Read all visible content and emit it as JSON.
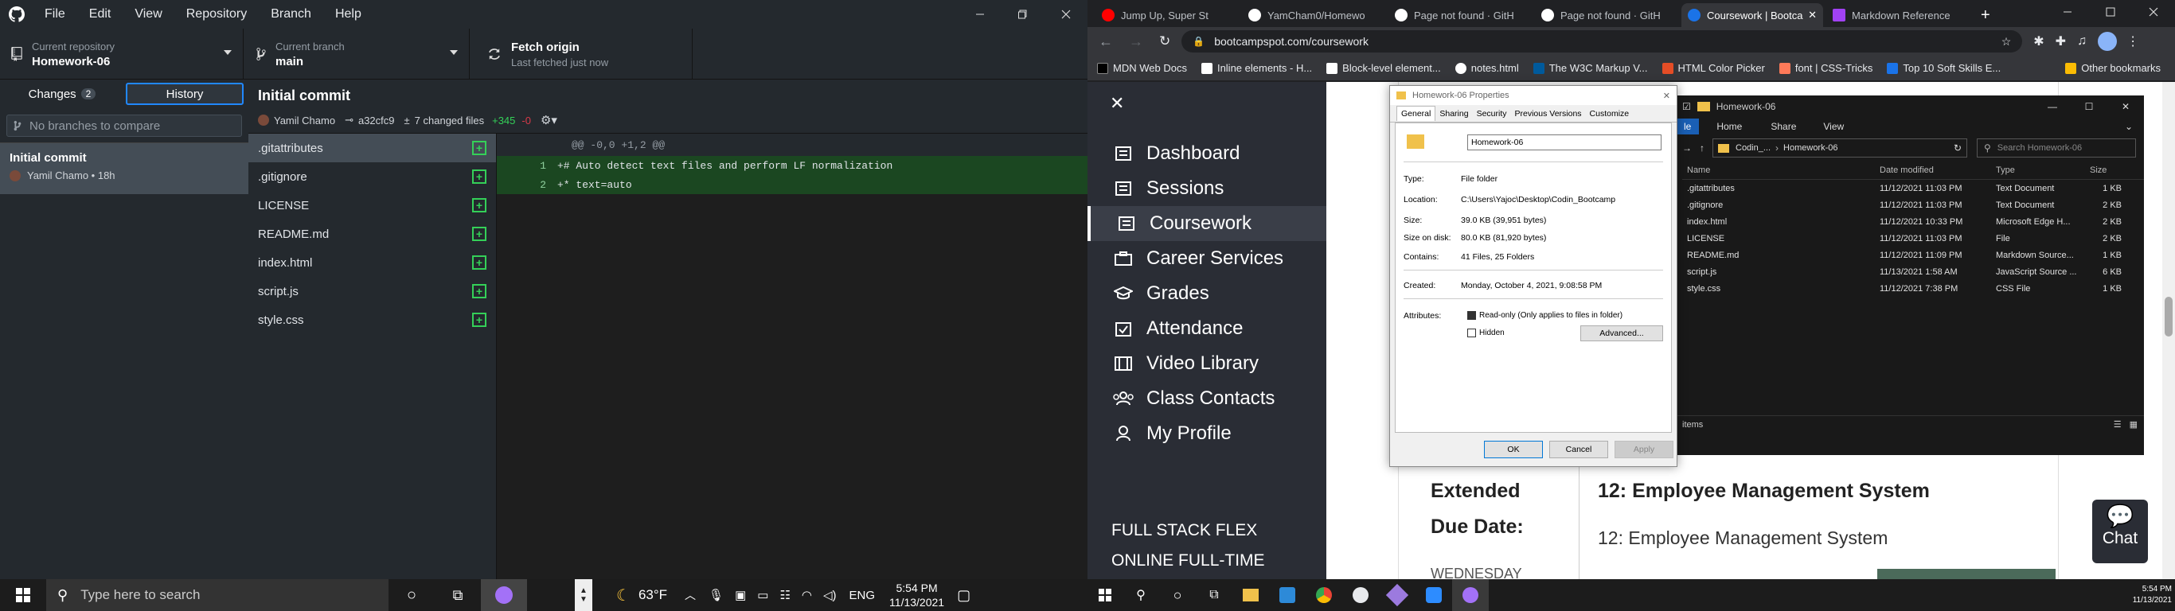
{
  "github": {
    "menu": [
      "File",
      "Edit",
      "View",
      "Repository",
      "Branch",
      "Help"
    ],
    "repo_label": "Current repository",
    "repo_value": "Homework-06",
    "branch_label": "Current branch",
    "branch_value": "main",
    "fetch_label": "Fetch origin",
    "fetch_sub": "Last fetched just now",
    "tab_changes": "Changes",
    "tab_changes_count": "2",
    "tab_history": "History",
    "filter_placeholder": "No branches to compare",
    "commit_title": "Initial commit",
    "commit_meta": "Yamil Chamo • 18h",
    "header_title": "Initial commit",
    "header_author": "Yamil Chamo",
    "header_sha": "a32cfc9",
    "header_files": "7 changed files",
    "header_add": "+345",
    "header_del": "-0",
    "files": [
      ".gitattributes",
      ".gitignore",
      "LICENSE",
      "README.md",
      "index.html",
      "script.js",
      "style.css"
    ],
    "diff_hunk": "@@ -0,0 +1,2 @@",
    "diff_lines": [
      {
        "n": "1",
        "text": "+# Auto detect text files and perform LF normalization"
      },
      {
        "n": "2",
        "text": "+* text=auto"
      }
    ]
  },
  "taskbar_left": {
    "search_placeholder": "Type here to search",
    "weather": "63°F",
    "lang": "ENG",
    "time": "5:54 PM",
    "date": "11/13/2021"
  },
  "chrome": {
    "tabs": [
      {
        "title": "Jump Up, Super St",
        "color": "#ff0000"
      },
      {
        "title": "YamCham0/Homewo",
        "color": "#ffffff"
      },
      {
        "title": "Page not found · GitH",
        "color": "#ffffff"
      },
      {
        "title": "Page not found · GitH",
        "color": "#ffffff"
      },
      {
        "title": "Coursework | Bootca",
        "color": "#1a73e8"
      },
      {
        "title": "Markdown Reference",
        "color": "#a142f4"
      }
    ],
    "url": "bootcampspot.com/coursework",
    "bookmarks": [
      "MDN Web Docs",
      "Inline elements - H...",
      "Block-level element...",
      "notes.html",
      "The W3C Markup V...",
      "HTML Color Picker",
      "font | CSS-Tricks",
      "Top 10 Soft Skills E..."
    ],
    "other_bookmarks": "Other bookmarks",
    "nav": [
      "Dashboard",
      "Sessions",
      "Coursework",
      "Career Services",
      "Grades",
      "Attendance",
      "Video Library",
      "Class Contacts",
      "My Profile"
    ],
    "nav_footer1": "FULL STACK FLEX",
    "nav_footer2": "ONLINE FULL-TIME",
    "ext_due": "Extended",
    "ext_due2": "Due Date:",
    "ext_day": "WEDNESDAY",
    "hw_title": "12: Employee Management System",
    "hw_sub": "12: Employee Management System",
    "chat": "Chat"
  },
  "properties": {
    "title": "Homework-06 Properties",
    "tabs": [
      "General",
      "Sharing",
      "Security",
      "Previous Versions",
      "Customize"
    ],
    "name": "Homework-06",
    "type_k": "Type:",
    "type_v": "File folder",
    "loc_k": "Location:",
    "loc_v": "C:\\Users\\Yajoc\\Desktop\\Codin_Bootcamp",
    "size_k": "Size:",
    "size_v": "39.0 KB (39,951 bytes)",
    "sod_k": "Size on disk:",
    "sod_v": "80.0 KB (81,920 bytes)",
    "cont_k": "Contains:",
    "cont_v": "41 Files, 25 Folders",
    "created_k": "Created:",
    "created_v": "Monday, October 4, 2021, 9:08:58 PM",
    "attr_k": "Attributes:",
    "readonly": "Read-only (Only applies to files in folder)",
    "hidden": "Hidden",
    "advanced": "Advanced...",
    "ok": "OK",
    "cancel": "Cancel",
    "apply": "Apply"
  },
  "explorer": {
    "title": "Homework-06",
    "ribbon": [
      "Home",
      "Share",
      "View"
    ],
    "path1": "Codin_...",
    "path2": "Homework-06",
    "search": "Search Homework-06",
    "cols": [
      "Name",
      "Date modified",
      "Type",
      "Size"
    ],
    "rows": [
      {
        "name": ".gitattributes",
        "date": "11/12/2021 11:03 PM",
        "type": "Text Document",
        "size": "1 KB"
      },
      {
        "name": ".gitignore",
        "date": "11/12/2021 11:03 PM",
        "type": "Text Document",
        "size": "2 KB"
      },
      {
        "name": "index.html",
        "date": "11/12/2021 10:33 PM",
        "type": "Microsoft Edge H...",
        "size": "2 KB"
      },
      {
        "name": "LICENSE",
        "date": "11/12/2021 11:03 PM",
        "type": "File",
        "size": "2 KB"
      },
      {
        "name": "README.md",
        "date": "11/12/2021 11:09 PM",
        "type": "Markdown Source...",
        "size": "1 KB"
      },
      {
        "name": "script.js",
        "date": "11/13/2021 1:58 AM",
        "type": "JavaScript Source ...",
        "size": "6 KB"
      },
      {
        "name": "style.css",
        "date": "11/12/2021 7:38 PM",
        "type": "CSS File",
        "size": "1 KB"
      }
    ],
    "status": "items"
  },
  "taskbar_right": {
    "time": "5:54 PM",
    "date": "11/13/2021"
  },
  "colors": {
    "accent": "#0366d6",
    "green": "#34d058",
    "red": "#d73a49",
    "nav_bg": "#2a2d35"
  }
}
